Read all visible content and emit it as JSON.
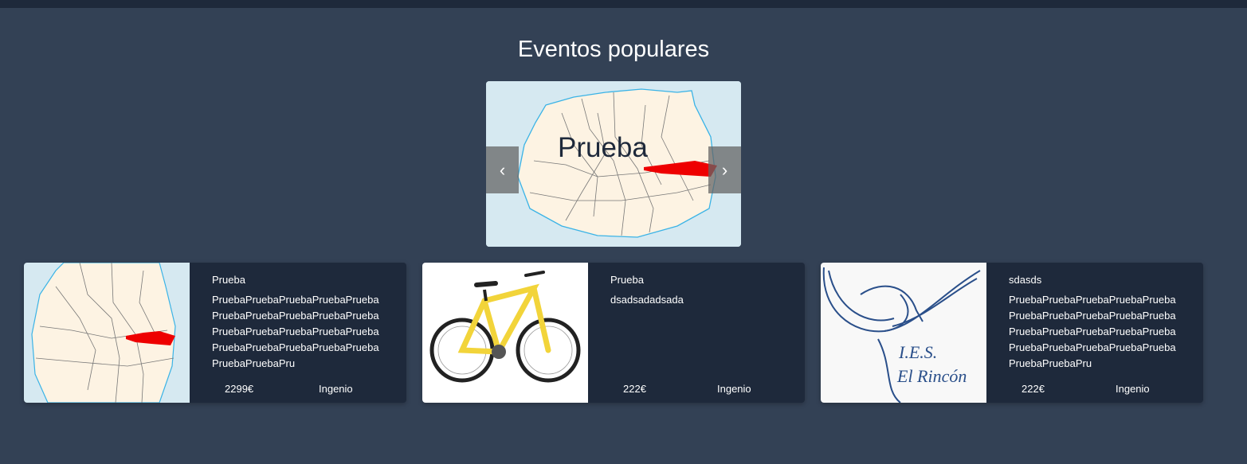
{
  "section": {
    "title": "Eventos populares"
  },
  "carousel": {
    "caption": "Prueba",
    "prev_label": "‹",
    "next_label": "›"
  },
  "events": [
    {
      "title": "Prueba",
      "description": "PruebaPruebaPruebaPruebaPruebaPruebaPruebaPruebaPruebaPruebaPruebaPruebaPruebaPruebaPruebaPruebaPruebaPruebaPruebaPruebaPruebaPruebaPru",
      "price": "2299€",
      "place": "Ingenio",
      "image": "map-image"
    },
    {
      "title": "Prueba",
      "description": "dsadsadadsada",
      "price": "222€",
      "place": "Ingenio",
      "image": "bicycle-image"
    },
    {
      "title": "sdasds",
      "description": "PruebaPruebaPruebaPruebaPruebaPruebaPruebaPruebaPruebaPruebaPruebaPruebaPruebaPruebaPruebaPruebaPruebaPruebaPruebaPruebaPruebaPruebaPru",
      "price": "222€",
      "place": "Ingenio",
      "image": "school-logo-image",
      "logo_text": [
        "I.E.S.",
        "El Rincón"
      ]
    }
  ],
  "colors": {
    "background": "#334155",
    "card": "#1e293b",
    "map_sea": "#d6e9f1",
    "map_land": "#fdf3e3",
    "route": "#ee0000"
  }
}
